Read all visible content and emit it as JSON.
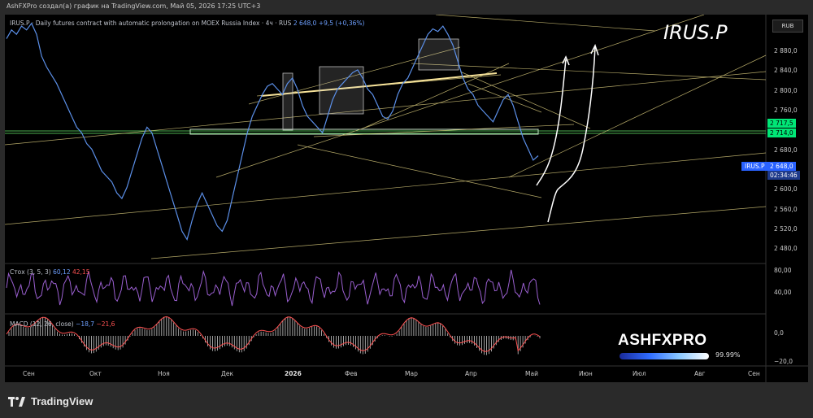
{
  "header": {
    "caption": "AshFXPro создал(а) график на TradingView.com, Май 05, 2026 17:25 UTC+3"
  },
  "legend": {
    "symbol_desc": "IRUS.P · Daily futures contract with automatic prolongation on MOEX Russia Index · 4ч · RUS",
    "price": "2 648,0",
    "change": "+9,5 (+0,36%)"
  },
  "overlay_title": "IRUS.P",
  "currency_button": "RUB",
  "price_axis": {
    "ticks": [
      "2 880,0",
      "2 840,0",
      "2 800,0",
      "2 760,0",
      "2 680,0",
      "2 600,0",
      "2 560,0",
      "2 520,0",
      "2 480,0"
    ],
    "level_badges": [
      "2 717,5",
      "2 714,0"
    ],
    "current_symbol": "IRUS.P",
    "current_price": "2 648,0",
    "countdown": "02:34:46"
  },
  "stoch": {
    "label": "Стох (3, 5, 3)",
    "k": "60,12",
    "d": "42,15",
    "ticks": [
      "80,00",
      "40,00"
    ]
  },
  "macd": {
    "label": "MACD (12, 26, close)",
    "v1": "−18,7",
    "v2": "−21,6",
    "ticks": [
      "0,0",
      "−20,0"
    ]
  },
  "time_axis": [
    "Сен",
    "Окт",
    "Ноя",
    "Дек",
    "2026",
    "Фев",
    "Мар",
    "Апр",
    "Май",
    "Июн",
    "Июл",
    "Авг",
    "Сен"
  ],
  "watermark": {
    "name": "ASHFXPRO",
    "percent": "99.99%"
  },
  "footer": {
    "brand": "TradingView"
  },
  "colors": {
    "price_line": "#5b8fe8",
    "level_line": "#4caf50",
    "trend_lines": "#f0e08a",
    "stoch": "#9a5fd0",
    "macd_hist": "#c8c8c8",
    "macd_line": "#ff5252",
    "forecast_arrow": "#ffffff"
  },
  "chart_data": {
    "type": "line",
    "ylim": [
      2460,
      2900
    ],
    "series": [
      {
        "name": "IRUS.P",
        "values": [
          2862,
          2878,
          2870,
          2885,
          2878,
          2890,
          2870,
          2830,
          2810,
          2795,
          2780,
          2760,
          2740,
          2720,
          2700,
          2690,
          2670,
          2660,
          2640,
          2620,
          2610,
          2600,
          2580,
          2570,
          2590,
          2620,
          2650,
          2680,
          2700,
          2690,
          2660,
          2630,
          2600,
          2570,
          2540,
          2510,
          2495,
          2530,
          2560,
          2580,
          2560,
          2540,
          2520,
          2510,
          2530,
          2570,
          2610,
          2650,
          2690,
          2720,
          2740,
          2760,
          2775,
          2780,
          2770,
          2760,
          2780,
          2790,
          2770,
          2740,
          2720,
          2710,
          2700,
          2690,
          2720,
          2750,
          2770,
          2780,
          2790,
          2800,
          2805,
          2790,
          2770,
          2760,
          2740,
          2720,
          2715,
          2730,
          2760,
          2780,
          2790,
          2810,
          2830,
          2850,
          2870,
          2880,
          2875,
          2885,
          2870,
          2850,
          2820,
          2790,
          2770,
          2760,
          2740,
          2730,
          2720,
          2710,
          2730,
          2750,
          2760,
          2740,
          2710,
          2680,
          2660,
          2640,
          2648
        ]
      }
    ]
  }
}
